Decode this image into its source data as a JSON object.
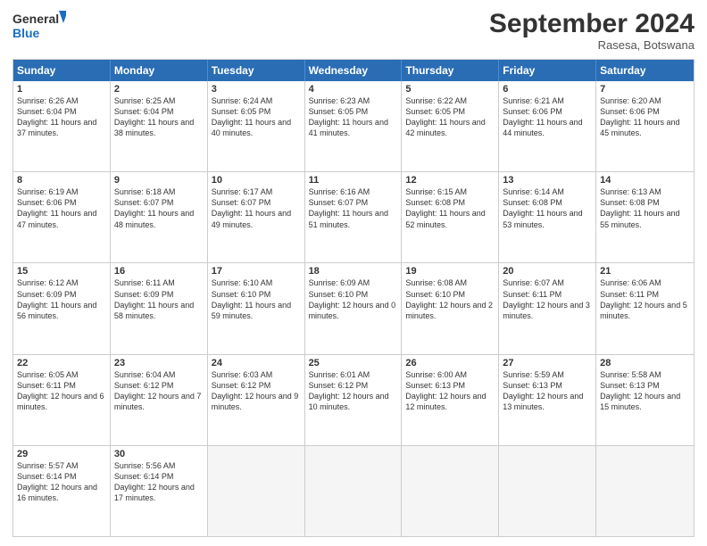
{
  "header": {
    "logo_line1": "General",
    "logo_line2": "Blue",
    "month_title": "September 2024",
    "location": "Rasesa, Botswana"
  },
  "day_names": [
    "Sunday",
    "Monday",
    "Tuesday",
    "Wednesday",
    "Thursday",
    "Friday",
    "Saturday"
  ],
  "rows": [
    [
      {
        "day": "1",
        "rise": "6:26 AM",
        "set": "6:04 PM",
        "hours": "11 hours and 37 minutes."
      },
      {
        "day": "2",
        "rise": "6:25 AM",
        "set": "6:04 PM",
        "hours": "11 hours and 38 minutes."
      },
      {
        "day": "3",
        "rise": "6:24 AM",
        "set": "6:05 PM",
        "hours": "11 hours and 40 minutes."
      },
      {
        "day": "4",
        "rise": "6:23 AM",
        "set": "6:05 PM",
        "hours": "11 hours and 41 minutes."
      },
      {
        "day": "5",
        "rise": "6:22 AM",
        "set": "6:05 PM",
        "hours": "11 hours and 42 minutes."
      },
      {
        "day": "6",
        "rise": "6:21 AM",
        "set": "6:06 PM",
        "hours": "11 hours and 44 minutes."
      },
      {
        "day": "7",
        "rise": "6:20 AM",
        "set": "6:06 PM",
        "hours": "11 hours and 45 minutes."
      }
    ],
    [
      {
        "day": "8",
        "rise": "6:19 AM",
        "set": "6:06 PM",
        "hours": "11 hours and 47 minutes."
      },
      {
        "day": "9",
        "rise": "6:18 AM",
        "set": "6:07 PM",
        "hours": "11 hours and 48 minutes."
      },
      {
        "day": "10",
        "rise": "6:17 AM",
        "set": "6:07 PM",
        "hours": "11 hours and 49 minutes."
      },
      {
        "day": "11",
        "rise": "6:16 AM",
        "set": "6:07 PM",
        "hours": "11 hours and 51 minutes."
      },
      {
        "day": "12",
        "rise": "6:15 AM",
        "set": "6:08 PM",
        "hours": "11 hours and 52 minutes."
      },
      {
        "day": "13",
        "rise": "6:14 AM",
        "set": "6:08 PM",
        "hours": "11 hours and 53 minutes."
      },
      {
        "day": "14",
        "rise": "6:13 AM",
        "set": "6:08 PM",
        "hours": "11 hours and 55 minutes."
      }
    ],
    [
      {
        "day": "15",
        "rise": "6:12 AM",
        "set": "6:09 PM",
        "hours": "11 hours and 56 minutes."
      },
      {
        "day": "16",
        "rise": "6:11 AM",
        "set": "6:09 PM",
        "hours": "11 hours and 58 minutes."
      },
      {
        "day": "17",
        "rise": "6:10 AM",
        "set": "6:10 PM",
        "hours": "11 hours and 59 minutes."
      },
      {
        "day": "18",
        "rise": "6:09 AM",
        "set": "6:10 PM",
        "hours": "12 hours and 0 minutes."
      },
      {
        "day": "19",
        "rise": "6:08 AM",
        "set": "6:10 PM",
        "hours": "12 hours and 2 minutes."
      },
      {
        "day": "20",
        "rise": "6:07 AM",
        "set": "6:11 PM",
        "hours": "12 hours and 3 minutes."
      },
      {
        "day": "21",
        "rise": "6:06 AM",
        "set": "6:11 PM",
        "hours": "12 hours and 5 minutes."
      }
    ],
    [
      {
        "day": "22",
        "rise": "6:05 AM",
        "set": "6:11 PM",
        "hours": "12 hours and 6 minutes."
      },
      {
        "day": "23",
        "rise": "6:04 AM",
        "set": "6:12 PM",
        "hours": "12 hours and 7 minutes."
      },
      {
        "day": "24",
        "rise": "6:03 AM",
        "set": "6:12 PM",
        "hours": "12 hours and 9 minutes."
      },
      {
        "day": "25",
        "rise": "6:01 AM",
        "set": "6:12 PM",
        "hours": "12 hours and 10 minutes."
      },
      {
        "day": "26",
        "rise": "6:00 AM",
        "set": "6:13 PM",
        "hours": "12 hours and 12 minutes."
      },
      {
        "day": "27",
        "rise": "5:59 AM",
        "set": "6:13 PM",
        "hours": "12 hours and 13 minutes."
      },
      {
        "day": "28",
        "rise": "5:58 AM",
        "set": "6:13 PM",
        "hours": "12 hours and 15 minutes."
      }
    ],
    [
      {
        "day": "29",
        "rise": "5:57 AM",
        "set": "6:14 PM",
        "hours": "12 hours and 16 minutes."
      },
      {
        "day": "30",
        "rise": "5:56 AM",
        "set": "6:14 PM",
        "hours": "12 hours and 17 minutes."
      },
      null,
      null,
      null,
      null,
      null
    ]
  ]
}
